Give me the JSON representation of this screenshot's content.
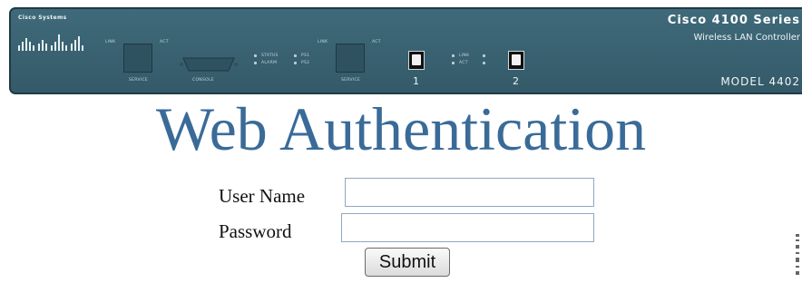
{
  "panel": {
    "brand": "Cisco Systems",
    "series_title": "Cisco 4100 Series",
    "series_subtitle": "Wireless LAN Controller",
    "model": "MODEL 4402",
    "labels": {
      "service_left": "SERVICE",
      "console": "CONSOLE",
      "service_right": "SERVICE",
      "link": "LINK",
      "act": "ACT",
      "status": "STATUS",
      "alarm": "ALARM",
      "ps1": "PS1",
      "ps2": "PS2"
    },
    "ports": [
      "1",
      "2"
    ]
  },
  "auth": {
    "title": "Web Authentication",
    "username_label": "User Name",
    "password_label": "Password",
    "username_value": "",
    "password_value": "",
    "submit_label": "Submit"
  },
  "colors": {
    "panel": "#3f6a7a",
    "title": "#3a6b98"
  }
}
